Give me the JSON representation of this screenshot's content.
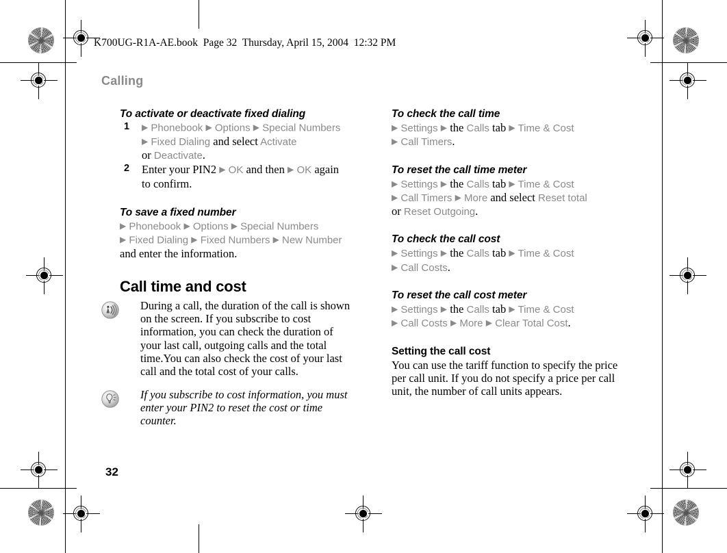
{
  "page": {
    "slugline": "K700UG-R1A-AE.book  Page 32  Thursday, April 15, 2004  12:32 PM",
    "running_head": "Calling",
    "folio": "32",
    "ui_term_color": "#8a8a8a",
    "body_color": "#000000"
  },
  "left_column": {
    "section1": {
      "heading": "To activate or deactivate fixed dialing",
      "steps": [
        {
          "number": "1",
          "lines": [
            [
              {
                "t": "arrow",
                "v": "▶"
              },
              {
                "t": "ui",
                "v": "Phonebook"
              },
              {
                "t": "arrow",
                "v": "▶"
              },
              {
                "t": "ui",
                "v": "Options"
              },
              {
                "t": "arrow",
                "v": "▶"
              },
              {
                "t": "ui",
                "v": "Special Numbers"
              }
            ],
            [
              {
                "t": "arrow",
                "v": "▶"
              },
              {
                "t": "ui",
                "v": "Fixed Dialing"
              },
              {
                "t": "plain",
                "v": "and select"
              },
              {
                "t": "ui",
                "v": "Activate"
              }
            ],
            [
              {
                "t": "plain",
                "v": "or"
              },
              {
                "t": "ui",
                "v": "Deactivate"
              },
              {
                "t": "plain",
                "v": "."
              }
            ]
          ]
        },
        {
          "number": "2",
          "lines": [
            [
              {
                "t": "plain",
                "v": "Enter your PIN2"
              },
              {
                "t": "arrow",
                "v": "▶"
              },
              {
                "t": "ui",
                "v": "OK"
              },
              {
                "t": "plain",
                "v": "and then"
              },
              {
                "t": "arrow",
                "v": "▶"
              },
              {
                "t": "ui",
                "v": "OK"
              },
              {
                "t": "plain",
                "v": "again"
              }
            ],
            [
              {
                "t": "plain",
                "v": "to confirm."
              }
            ]
          ]
        }
      ]
    },
    "section2": {
      "heading": "To save a fixed number",
      "lines": [
        [
          {
            "t": "arrow",
            "v": "▶"
          },
          {
            "t": "ui",
            "v": "Phonebook"
          },
          {
            "t": "arrow",
            "v": "▶"
          },
          {
            "t": "ui",
            "v": "Options"
          },
          {
            "t": "arrow",
            "v": "▶"
          },
          {
            "t": "ui",
            "v": "Special Numbers"
          }
        ],
        [
          {
            "t": "arrow",
            "v": "▶"
          },
          {
            "t": "ui",
            "v": "Fixed Dialing"
          },
          {
            "t": "arrow",
            "v": "▶"
          },
          {
            "t": "ui",
            "v": "Fixed Numbers"
          },
          {
            "t": "arrow",
            "v": "▶"
          },
          {
            "t": "ui",
            "v": "New Number"
          }
        ],
        [
          {
            "t": "plain",
            "v": "and enter the information."
          }
        ]
      ]
    },
    "section3": {
      "heading": "Call time and cost",
      "note_icon": "call-sound-icon",
      "note_text": "During a call, the duration of the call is shown on the screen. If you subscribe to cost information, you can check the duration of your last call, outgoing calls and the total time.You can also check the cost of your last call and the total cost of your calls.",
      "tip_icon": "lightbulb-tip-icon",
      "tip_text": "If you subscribe to cost information, you must enter your PIN2 to reset the cost or time counter."
    }
  },
  "right_column": {
    "section1": {
      "heading": "To check the call time",
      "lines": [
        [
          {
            "t": "arrow",
            "v": "▶"
          },
          {
            "t": "ui",
            "v": "Settings"
          },
          {
            "t": "arrow",
            "v": "▶"
          },
          {
            "t": "plain",
            "v": "the"
          },
          {
            "t": "ui",
            "v": "Calls"
          },
          {
            "t": "plain",
            "v": "tab"
          },
          {
            "t": "arrow",
            "v": "▶"
          },
          {
            "t": "ui",
            "v": "Time & Cost"
          }
        ],
        [
          {
            "t": "arrow",
            "v": "▶"
          },
          {
            "t": "ui",
            "v": "Call Timers"
          },
          {
            "t": "plain",
            "v": "."
          }
        ]
      ]
    },
    "section2": {
      "heading": "To reset the call time meter",
      "lines": [
        [
          {
            "t": "arrow",
            "v": "▶"
          },
          {
            "t": "ui",
            "v": "Settings"
          },
          {
            "t": "arrow",
            "v": "▶"
          },
          {
            "t": "plain",
            "v": "the"
          },
          {
            "t": "ui",
            "v": "Calls"
          },
          {
            "t": "plain",
            "v": "tab"
          },
          {
            "t": "arrow",
            "v": "▶"
          },
          {
            "t": "ui",
            "v": "Time & Cost"
          }
        ],
        [
          {
            "t": "arrow",
            "v": "▶"
          },
          {
            "t": "ui",
            "v": "Call Timers"
          },
          {
            "t": "arrow",
            "v": "▶"
          },
          {
            "t": "ui",
            "v": "More"
          },
          {
            "t": "plain",
            "v": "and select"
          },
          {
            "t": "ui",
            "v": "Reset total"
          }
        ],
        [
          {
            "t": "plain",
            "v": "or"
          },
          {
            "t": "ui",
            "v": "Reset Outgoing"
          },
          {
            "t": "plain",
            "v": "."
          }
        ]
      ]
    },
    "section3": {
      "heading": "To check the call cost",
      "lines": [
        [
          {
            "t": "arrow",
            "v": "▶"
          },
          {
            "t": "ui",
            "v": "Settings"
          },
          {
            "t": "arrow",
            "v": "▶"
          },
          {
            "t": "plain",
            "v": "the"
          },
          {
            "t": "ui",
            "v": "Calls"
          },
          {
            "t": "plain",
            "v": "tab"
          },
          {
            "t": "arrow",
            "v": "▶"
          },
          {
            "t": "ui",
            "v": "Time & Cost"
          }
        ],
        [
          {
            "t": "arrow",
            "v": "▶"
          },
          {
            "t": "ui",
            "v": "Call Costs"
          },
          {
            "t": "plain",
            "v": "."
          }
        ]
      ]
    },
    "section4": {
      "heading": "To reset the call cost meter",
      "lines": [
        [
          {
            "t": "arrow",
            "v": "▶"
          },
          {
            "t": "ui",
            "v": "Settings"
          },
          {
            "t": "arrow",
            "v": "▶"
          },
          {
            "t": "plain",
            "v": "the"
          },
          {
            "t": "ui",
            "v": "Calls"
          },
          {
            "t": "plain",
            "v": "tab"
          },
          {
            "t": "arrow",
            "v": "▶"
          },
          {
            "t": "ui",
            "v": "Time & Cost"
          }
        ],
        [
          {
            "t": "arrow",
            "v": "▶"
          },
          {
            "t": "ui",
            "v": "Call Costs"
          },
          {
            "t": "arrow",
            "v": "▶"
          },
          {
            "t": "ui",
            "v": "More"
          },
          {
            "t": "arrow",
            "v": "▶"
          },
          {
            "t": "ui",
            "v": "Clear Total Cost"
          },
          {
            "t": "plain",
            "v": "."
          }
        ]
      ]
    },
    "section5": {
      "heading": "Setting the call cost",
      "text": "You can use the tariff function to specify the price per call unit. If you do not specify a price per call unit, the number of call units appears."
    }
  }
}
